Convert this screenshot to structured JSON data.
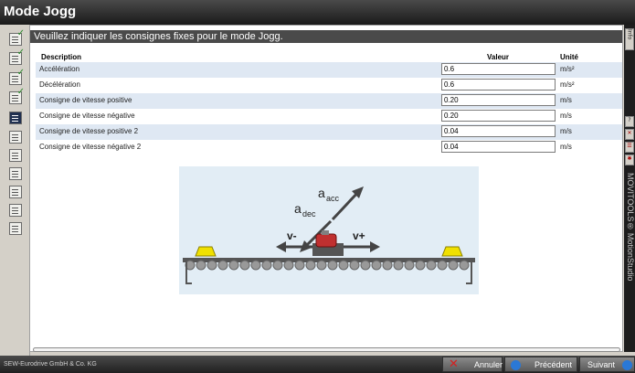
{
  "window": {
    "title": "Mode Jogg"
  },
  "panel": {
    "header": "Veuillez indiquer les consignes fixes pour le mode Jogg."
  },
  "table": {
    "columns": {
      "description": "Description",
      "value": "Valeur",
      "unit": "Unité"
    },
    "rows": [
      {
        "description": "Accélération",
        "value": "0.6",
        "unit": "m/s²"
      },
      {
        "description": "Décélération",
        "value": "0.6",
        "unit": "m/s²"
      },
      {
        "description": "Consigne de vitesse positive",
        "value": "0.20",
        "unit": "m/s"
      },
      {
        "description": "Consigne de vitesse négative",
        "value": "0.20",
        "unit": "m/s"
      },
      {
        "description": "Consigne de vitesse positive 2",
        "value": "0.04",
        "unit": "m/s"
      },
      {
        "description": "Consigne de vitesse négative 2",
        "value": "0.04",
        "unit": "m/s"
      }
    ]
  },
  "diagram": {
    "labels": {
      "acc": "a",
      "acc_sub": "acc",
      "dec": "a",
      "dec_sub": "dec",
      "vneg": "v-",
      "vpos": "v+"
    }
  },
  "right_bar": {
    "tabs": [
      "Info",
      "?"
    ],
    "brand_text": "MOVITOOLS® MotionStudio"
  },
  "footer": {
    "copyright": "SEW-Eurodrive GmbH & Co. KG",
    "buttons": {
      "cancel": "Annuler",
      "previous": "Précédent",
      "next": "Suivant"
    }
  },
  "colors": {
    "title_bar": "#2a2a2a",
    "alt_row": "#dfe8f3",
    "diagram_bg": "#e2edf5",
    "cancel_icon": "#d42020",
    "nav_icon": "#2a78d6",
    "motor": "#c03030",
    "load": "#f0e000"
  }
}
